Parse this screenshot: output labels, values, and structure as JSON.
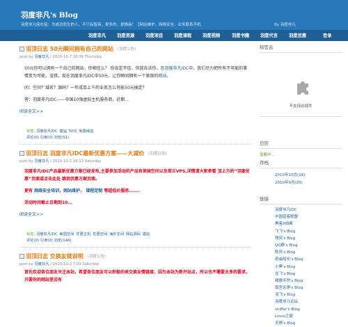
{
  "header": {
    "title": "羽度非凡's Blog",
    "description": "羽度非凡座右铭：为成功而生的人，不只有智商，更多的，是情商！【网站维护、网络安全、业务联系手机",
    "by": "By 羽度非凡"
  },
  "nav": [
    "羽度非凡",
    "羽度资源",
    "羽度项目",
    "羽度课程",
    "羽度视频",
    "羽度书籍",
    "羽度代言",
    "羽度优惠",
    "登录"
  ],
  "posts": [
    {
      "title": "羽顶日志 50元瞬间拥有自己的网站",
      "category": "(羽度公告)",
      "author": "羽度非凡",
      "date": "2010-10-7 16:39 Thursday",
      "body": [
        "50元你可以拥有一个自己的网站，你相信么？ 你肯定不信，但我告诉你，在",
        "羽度非凡IDC",
        "中，我们尽力把所有不可能的事情变为可能，没错，现在羽度非凡IDC中50元，让你瞬间拥有一个美观的",
        "网站",
        "。",
        "问：空间？域名？源码？一年成百上千的业务怎么可能50元搞定？",
        "答：羽度非凡IDC——中国10强虚拟主机服务商，近期..."
      ],
      "read_more": "阅读全文>>",
      "tags_label": "标签:",
      "tags": [
        "羽度非凡IDC",
        "建站",
        "50元",
        "免费域名"
      ],
      "comments": "评论(0) 引用(0) 浏览(51)"
    },
    {
      "title": "羽顶日志 羽度非凡IDC最新优惠方案——大减价",
      "category": "(羽度公告)",
      "author": "羽度非凡",
      "date": "2010-10-2 18:13 Saturday",
      "body": [
        "羽度非凡IDC产品最新优惠方案已经发布,主要参加活动的产品有美国空间以及荷兰VPS,详情请大家参看 顶上方的“羽度优惠”页面或点击此处 跳到优惠方案页面。",
        "更有",
        "网络安全培训",
        "，",
        "网站维护",
        "，",
        "课程定制",
        "等超低价服务.......",
        "活动时间截止日期到10..."
      ],
      "read_more": "阅读全文>>",
      "tags_label": "标签:",
      "tags": [
        "羽度非凡IDC",
        "美国空间",
        "优惠主机",
        "优惠空间",
        "海外空间",
        "网站源码",
        "建站"
      ],
      "comments": "评论(0) 引用(0) 浏览(146)"
    },
    {
      "title": "羽顶日志 交换友链说明",
      "category": "(羽度公告)",
      "author": "羽度非凡",
      "date": "2010-10-2 7:09 Saturday",
      "body": [
        "首先欢迎各位朋友关注本站，希望各位朋友可以积极的来交换友情链接，因为本站为新开站点，所以也不需要太多的要求，只要你的网站里没有"
      ]
    }
  ],
  "sidebar": {
    "tag_cloud_title": "标签云",
    "plugin_text": "不支持此插件",
    "calendar_title": "日历",
    "calendar_loading": "加载中...",
    "archive_title": "存档",
    "archives": [
      "2010年10月(16)",
      "2010年9月(29)"
    ],
    "links_title": "链接",
    "links": [
      "羽度非凡IDC",
      "中国蓝客联盟",
      "黑客X档案",
      "飞飞's Blog",
      "残风's Blog",
      "QQ群's Blog",
      "陈风's Blog",
      "邑遥船长's Blog",
      "小黑's Blog",
      "龙飞's Blog",
      "啸傲不然's Blog",
      "南宫无诤's Blog",
      "羽飞's Blog",
      "羽度非凡论坛",
      "sniffer's Blog",
      "Linux之家",
      "无情's Blog"
    ]
  },
  "colors": {
    "header_bg": "#2778b8",
    "nav_bg": "#1e5f96",
    "title_orange": "#e87a14",
    "link_blue": "#1b5e9e",
    "alert_red": "#e0001a"
  }
}
